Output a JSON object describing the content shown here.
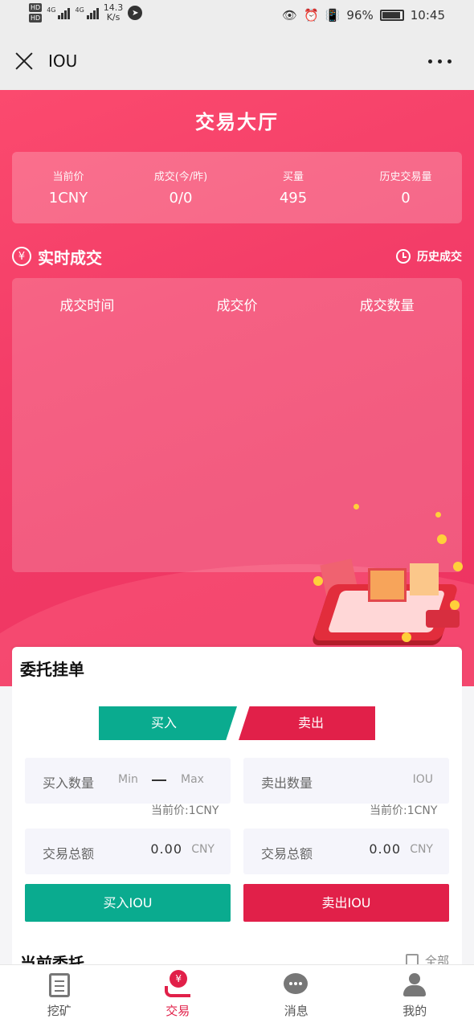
{
  "status_bar": {
    "network_speed_value": "14.3",
    "network_speed_unit": "K/s",
    "battery": "96%",
    "time": "10:45",
    "signal_label_1": "4G",
    "signal_label_2": "4G",
    "hd1": "HD",
    "hd2": "HD"
  },
  "title_bar": {
    "title": "IOU"
  },
  "hero": {
    "title": "交易大厅",
    "stats": [
      {
        "label": "当前价",
        "value": "1CNY"
      },
      {
        "label": "成交(今/昨)",
        "value": "0/0"
      },
      {
        "label": "买量",
        "value": "495"
      },
      {
        "label": "历史交易量",
        "value": "0"
      }
    ],
    "realtime_title": "实时成交",
    "yen_symbol": "¥",
    "history_link": "历史成交",
    "table_headers": [
      "成交时间",
      "成交价",
      "成交数量"
    ]
  },
  "order": {
    "title": "委托挂单",
    "tab_buy": "买入",
    "tab_sell": "卖出",
    "buy_qty_label": "买入数量",
    "buy_qty_min_placeholder": "Min",
    "buy_qty_max_placeholder": "Max",
    "sell_qty_label": "卖出数量",
    "sell_qty_unit": "IOU",
    "buy_current_price": "当前价:1CNY",
    "sell_current_price": "当前价:1CNY",
    "buy_total_label": "交易总额",
    "buy_total_value": "0.00",
    "buy_total_currency": "CNY",
    "sell_total_label": "交易总额",
    "sell_total_value": "0.00",
    "sell_total_currency": "CNY",
    "buy_button": "买入IOU",
    "sell_button": "卖出IOU",
    "current_orders_title": "当前委托",
    "all_link": "全部"
  },
  "tab_bar": {
    "items": [
      {
        "label": "挖矿",
        "icon": "mining-icon"
      },
      {
        "label": "交易",
        "icon": "trade-icon"
      },
      {
        "label": "消息",
        "icon": "message-icon"
      },
      {
        "label": "我的",
        "icon": "profile-icon"
      }
    ],
    "active_index": 1
  },
  "colors": {
    "hero_red": "#f33d68",
    "buy_green": "#0aab8f",
    "sell_red": "#e12049"
  }
}
